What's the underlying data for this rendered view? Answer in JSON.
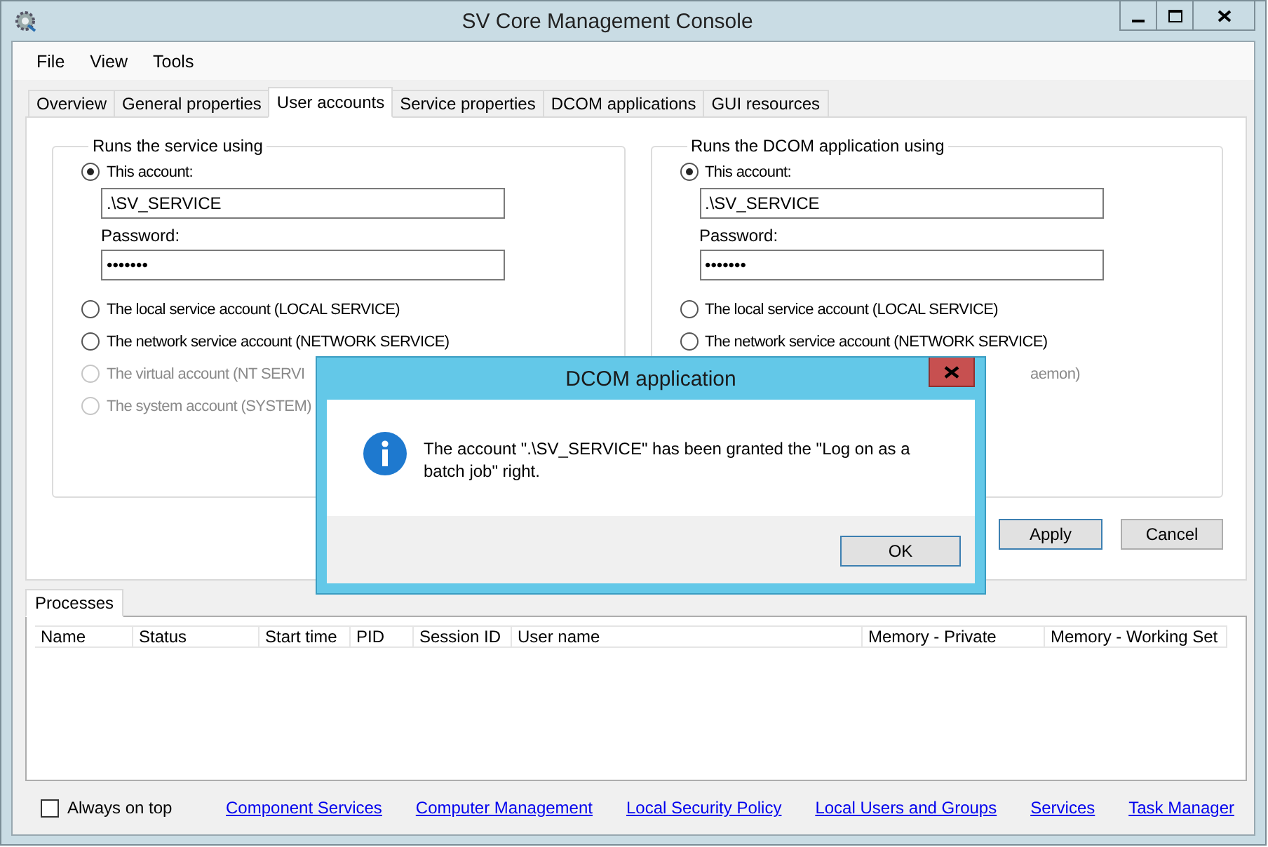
{
  "window": {
    "title": "SV Core Management Console"
  },
  "menu": [
    {
      "label": "File"
    },
    {
      "label": "View"
    },
    {
      "label": "Tools"
    }
  ],
  "tabs": [
    {
      "label": "Overview",
      "selected": false
    },
    {
      "label": "General properties",
      "selected": false
    },
    {
      "label": "User accounts",
      "selected": true
    },
    {
      "label": "Service properties",
      "selected": false
    },
    {
      "label": "DCOM applications",
      "selected": false
    },
    {
      "label": "GUI resources",
      "selected": false
    }
  ],
  "groups": [
    {
      "title": "Runs the service using",
      "options": [
        {
          "kind": "account",
          "label": "This account:",
          "selected": true,
          "disabled": false,
          "account": ".\\SV_SERVICE",
          "password_label": "Password:",
          "password": "•••••••"
        },
        {
          "kind": "radio",
          "label": "The local service account (LOCAL SERVICE)",
          "selected": false,
          "disabled": false
        },
        {
          "kind": "radio",
          "label": "The network service account (NETWORK SERVICE)",
          "selected": false,
          "disabled": false
        },
        {
          "kind": "radio",
          "label": "The virtual account (NT SERVI",
          "selected": false,
          "disabled": true
        },
        {
          "kind": "radio",
          "label": "The system account (SYSTEM)",
          "selected": false,
          "disabled": true
        }
      ]
    },
    {
      "title": "Runs the DCOM application using",
      "options": [
        {
          "kind": "account",
          "label": "This account:",
          "selected": true,
          "disabled": false,
          "account": ".\\SV_SERVICE",
          "password_label": "Password:",
          "password": "•••••••"
        },
        {
          "kind": "radio",
          "label": "The local service account (LOCAL SERVICE)",
          "selected": false,
          "disabled": false
        },
        {
          "kind": "radio",
          "label": "The network service account (NETWORK SERVICE)",
          "selected": false,
          "disabled": false
        },
        {
          "kind": "tail",
          "label": "aemon)",
          "disabled": true
        }
      ]
    }
  ],
  "buttons": [
    {
      "label": "Apply"
    },
    {
      "label": "Cancel"
    }
  ],
  "processes": {
    "tab": {
      "label": "Processes",
      "selected": true
    },
    "columns": [
      "Name",
      "Status",
      "Start time",
      "PID",
      "Session ID",
      "User name",
      "Memory - Private",
      "Memory - Working Set"
    ]
  },
  "footer": {
    "always_on_top": {
      "label": "Always on top",
      "checked": false
    },
    "links": [
      "Component Services",
      "Computer Management",
      "Local Security Policy",
      "Local Users and Groups",
      "Services",
      "Task Manager"
    ]
  },
  "dialog": {
    "title": "DCOM application",
    "message": "The account \".\\SV_SERVICE\" has been granted the \"Log on as a batch job\" right.",
    "button": "OK"
  }
}
